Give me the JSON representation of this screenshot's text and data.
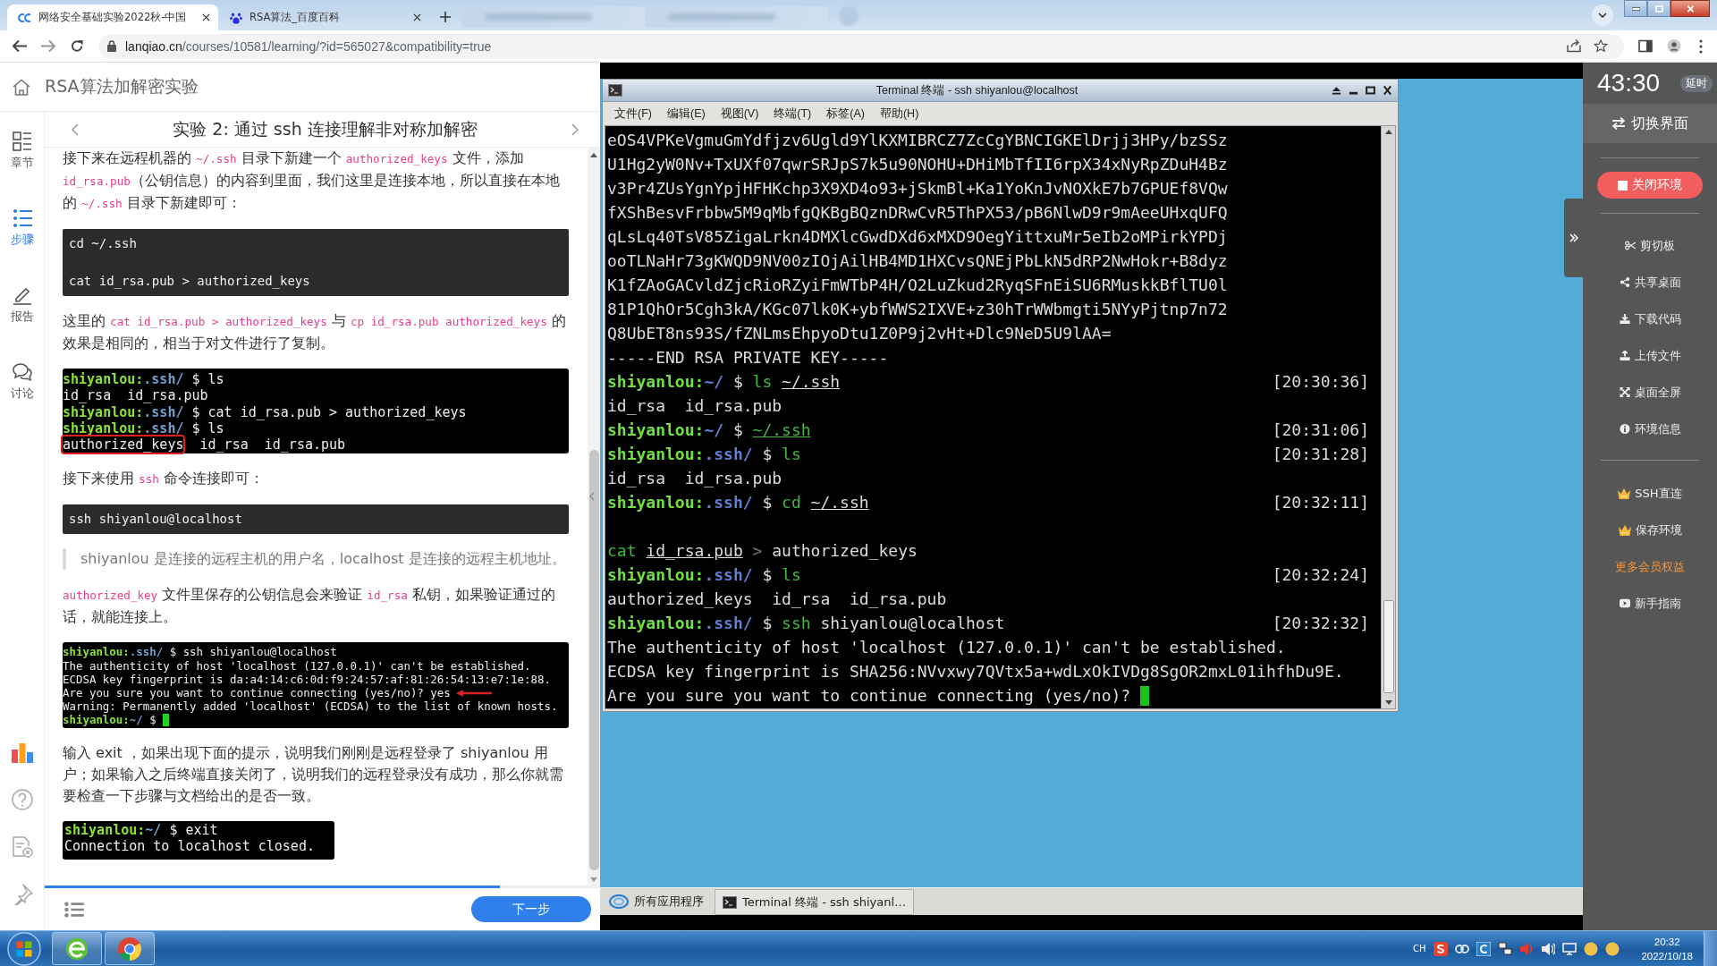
{
  "browser": {
    "tabs": [
      {
        "title": "网络安全基础实验2022秋-中国",
        "selected": true
      },
      {
        "title": "RSA算法_百度百科",
        "selected": false
      }
    ],
    "url": {
      "host": "lanqiao.cn",
      "path": "/courses/10581/learning/?id=565027&compatibility=true"
    }
  },
  "course": {
    "title": "RSA算法加解密实验",
    "rail": [
      {
        "label": "章节",
        "selected": false
      },
      {
        "label": "步骤",
        "selected": true
      },
      {
        "label": "报告",
        "selected": false
      },
      {
        "label": "讨论",
        "selected": false
      }
    ],
    "step_title": "实验 2: 通过 ssh 连接理解非对称加解密",
    "blocks": [
      {
        "kind": "para",
        "parts": [
          {
            "text": "接下来在远程机器的 ",
            "code": false
          },
          {
            "text": "~/.ssh",
            "code": true
          },
          {
            "text": " 目录下新建一个 ",
            "code": false
          },
          {
            "text": "authorized_keys",
            "code": true
          },
          {
            "text": " 文件，添加 ",
            "code": false
          },
          {
            "text": "id_rsa.pub",
            "code": true
          },
          {
            "text": "（公钥信息）的内容到里面，我们这里是连接本地，所以直接在本地的 ",
            "code": false
          },
          {
            "text": "~/.ssh",
            "code": true
          },
          {
            "text": " 目录下新建即可：",
            "code": false
          }
        ]
      },
      {
        "kind": "code",
        "text": "cd ~/.ssh\n\ncat id_rsa.pub > authorized_keys"
      },
      {
        "kind": "para",
        "parts": [
          {
            "text": "这里的 ",
            "code": false
          },
          {
            "text": "cat id_rsa.pub > authorized_keys",
            "code": true
          },
          {
            "text": " 与 ",
            "code": false
          },
          {
            "text": "cp id_rsa.pub authorized_keys",
            "code": true
          },
          {
            "text": " 的效果是相同的，相当于对文件进行了复制。",
            "code": false
          }
        ]
      },
      {
        "kind": "shot",
        "lines": [
          {
            "segments": [
              {
                "kind": "user",
                "text": "shiyanlou:"
              },
              {
                "kind": "dir",
                "text": ".ssh/"
              },
              {
                "kind": "text",
                "text": " $ ls"
              }
            ]
          },
          {
            "segments": [
              {
                "kind": "text",
                "text": "id_rsa  id_rsa.pub"
              }
            ]
          },
          {
            "segments": [
              {
                "kind": "user",
                "text": "shiyanlou:"
              },
              {
                "kind": "dir",
                "text": ".ssh/"
              },
              {
                "kind": "text",
                "text": " $ cat id_rsa.pub > authorized_keys"
              }
            ]
          },
          {
            "segments": [
              {
                "kind": "user",
                "text": "shiyanlou:"
              },
              {
                "kind": "dir",
                "text": ".ssh/"
              },
              {
                "kind": "text",
                "text": " $ ls"
              }
            ]
          },
          {
            "segments": [
              {
                "kind": "boxed",
                "text": "authorized_keys"
              },
              {
                "kind": "text",
                "text": "  id_rsa  id_rsa.pub"
              }
            ]
          }
        ]
      },
      {
        "kind": "para",
        "parts": [
          {
            "text": "接下来使用 ",
            "code": false
          },
          {
            "text": "ssh",
            "code": true
          },
          {
            "text": " 命令连接即可：",
            "code": false
          }
        ]
      },
      {
        "kind": "code",
        "text": "ssh shiyanlou@localhost"
      },
      {
        "kind": "quote",
        "text": "shiyanlou 是连接的远程主机的用户名，localhost 是连接的远程主机地址。"
      },
      {
        "kind": "para",
        "parts": [
          {
            "text": "authorized_key",
            "code": true
          },
          {
            "text": " 文件里保存的公钥信息会来验证 ",
            "code": false
          },
          {
            "text": "id_rsa",
            "code": true
          },
          {
            "text": " 私钥，如果验证通过的话，就能连接上。",
            "code": false
          }
        ]
      },
      {
        "kind": "shot",
        "lines": [
          {
            "segments": [
              {
                "kind": "user",
                "text": "shiyanlou:"
              },
              {
                "kind": "dir",
                "text": ".ssh/"
              },
              {
                "kind": "text",
                "text": " $ ssh shiyanlou@localhost"
              }
            ]
          },
          {
            "segments": [
              {
                "kind": "text",
                "text": "The authenticity of host 'localhost (127.0.0.1)' can't be established."
              }
            ]
          },
          {
            "segments": [
              {
                "kind": "text",
                "text": "ECDSA key fingerprint is da:a4:14:c6:0d:f9:24:57:af:81:26:54:13:e7:1e:88."
              }
            ]
          },
          {
            "segments": [
              {
                "kind": "text",
                "text": "Are you sure you want to continue connecting (yes/no)? yes"
              },
              {
                "kind": "arrow"
              }
            ]
          },
          {
            "segments": [
              {
                "kind": "text",
                "text": "Warning: Permanently added 'localhost' (ECDSA) to the list of known hosts."
              }
            ]
          },
          {
            "segments": [
              {
                "kind": "user",
                "text": "shiyanlou:"
              },
              {
                "kind": "dir",
                "text": "~/"
              },
              {
                "kind": "text",
                "text": " $ "
              },
              {
                "kind": "cursor"
              }
            ]
          }
        ]
      },
      {
        "kind": "para",
        "parts": [
          {
            "text": "输入 exit ，如果出现下面的提示，说明我们刚刚是远程登录了 shiyanlou 用户；如果输入之后终端直接关闭了，说明我们的远程登录没有成功，那么你就需要检查一下步骤与文档给出的是否一致。",
            "code": false
          }
        ]
      },
      {
        "kind": "shot",
        "lines": [
          {
            "segments": [
              {
                "kind": "user",
                "text": "shiyanlou:"
              },
              {
                "kind": "dir",
                "text": "~/"
              },
              {
                "kind": "text",
                "text": " $ exit"
              }
            ]
          },
          {
            "segments": [
              {
                "kind": "text",
                "text": "Connection to localhost closed."
              }
            ]
          }
        ]
      }
    ],
    "progress": {
      "level": 0.82
    },
    "next_button": "下一步"
  },
  "desktop": {
    "terminal": {
      "title": "Terminal 终端 - ssh shiyanlou@localhost",
      "menu": [
        "文件(F)",
        "编辑(E)",
        "视图(V)",
        "终端(T)",
        "标签(A)",
        "帮助(H)"
      ],
      "lines": [
        {
          "kind": "line",
          "segments": [
            {
              "kind": "text",
              "text": "eOS4VPKeVgmuGmYdfjzv6Ugld9YlKXMIBRCZ7ZcCgYBNCIGKElDrjj3HPy/bzSSz"
            }
          ]
        },
        {
          "kind": "line",
          "segments": [
            {
              "kind": "text",
              "text": "U1Hg2yW0Nv+TxUXf07qwrSRJpS7k5u90NOHU+DHiMbTfII6rpX34xNyRpZDuH4Bz"
            }
          ]
        },
        {
          "kind": "line",
          "segments": [
            {
              "kind": "text",
              "text": "v3Pr4ZUsYgnYpjHFHKchp3X9XD4o93+jSkmBl+Ka1YoKnJvNOXkE7b7GPUEf8VQw"
            }
          ]
        },
        {
          "kind": "line",
          "segments": [
            {
              "kind": "text",
              "text": "fXShBesvFrbbw5M9qMbfgQKBgBQznDRwCvR5ThPX53/pB6NlwD9r9mAeeUHxqUFQ"
            }
          ]
        },
        {
          "kind": "line",
          "segments": [
            {
              "kind": "text",
              "text": "qLsLq40TsV85ZigaLrkn4DMXlcGwdDXd6xMXD9OegYittxuMr5eIb2oMPirkYPDj"
            }
          ]
        },
        {
          "kind": "line",
          "segments": [
            {
              "kind": "text",
              "text": "ooTLNaHr73gKWQD9NV00zIOjAilHB4MD1HXCvsQNEjPbLkN5dRP2NwHokr+B8dyz"
            }
          ]
        },
        {
          "kind": "line",
          "segments": [
            {
              "kind": "text",
              "text": "K1fZAoGACvldZjcRioRZyiFmWTbP4H/O2LuZkud2RyqSFnEiSU6RMuskkBflTU0l"
            }
          ]
        },
        {
          "kind": "line",
          "segments": [
            {
              "kind": "text",
              "text": "81P1QhOr5Cgh3kA/KGc07lk0K+ybfWWS2IXVE+z30hTrWWbmgti5NYyPjtnp7n72"
            }
          ]
        },
        {
          "kind": "line",
          "segments": [
            {
              "kind": "text",
              "text": "Q8UbET8ns93S/fZNLmsEhpyoDtu1Z0P9j2vHt+Dlc9NeD5U9lAA="
            }
          ]
        },
        {
          "kind": "line",
          "segments": [
            {
              "kind": "text",
              "text": "-----END RSA PRIVATE KEY-----"
            }
          ]
        },
        {
          "kind": "line",
          "segments": [
            {
              "kind": "user",
              "text": "shiyanlou:"
            },
            {
              "kind": "dir",
              "text": "~/"
            },
            {
              "kind": "text",
              "text": " $ "
            },
            {
              "kind": "cmd",
              "text": "ls "
            },
            {
              "kind": "path",
              "text": "~/.ssh"
            }
          ],
          "time": "[20:30:36]"
        },
        {
          "kind": "line",
          "segments": [
            {
              "kind": "text",
              "text": "id_rsa  id_rsa.pub"
            }
          ]
        },
        {
          "kind": "line",
          "segments": [
            {
              "kind": "user",
              "text": "shiyanlou:"
            },
            {
              "kind": "dir",
              "text": "~/"
            },
            {
              "kind": "text",
              "text": " $ "
            },
            {
              "kind": "cmd_path",
              "text": "~/.ssh"
            }
          ],
          "time": "[20:31:06]"
        },
        {
          "kind": "line",
          "segments": [
            {
              "kind": "user",
              "text": "shiyanlou:"
            },
            {
              "kind": "dir",
              "text": ".ssh/"
            },
            {
              "kind": "text",
              "text": " $ "
            },
            {
              "kind": "cmd",
              "text": "ls"
            }
          ],
          "time": "[20:31:28]"
        },
        {
          "kind": "line",
          "segments": [
            {
              "kind": "text",
              "text": "id_rsa  id_rsa.pub"
            }
          ]
        },
        {
          "kind": "line",
          "segments": [
            {
              "kind": "user",
              "text": "shiyanlou:"
            },
            {
              "kind": "dir",
              "text": ".ssh/"
            },
            {
              "kind": "text",
              "text": " $ "
            },
            {
              "kind": "cmd",
              "text": "cd "
            },
            {
              "kind": "path",
              "text": "~/.ssh"
            }
          ],
          "time": "[20:32:11]"
        },
        {
          "kind": "blank"
        },
        {
          "kind": "line",
          "segments": [
            {
              "kind": "cmd",
              "text": "cat "
            },
            {
              "kind": "path",
              "text": "id_rsa.pub"
            },
            {
              "kind": "op",
              "text": " > "
            },
            {
              "kind": "text",
              "text": "authorized_keys"
            }
          ]
        },
        {
          "kind": "line",
          "segments": [
            {
              "kind": "user",
              "text": "shiyanlou:"
            },
            {
              "kind": "dir",
              "text": ".ssh/"
            },
            {
              "kind": "text",
              "text": " $ "
            },
            {
              "kind": "cmd",
              "text": "ls"
            }
          ],
          "time": "[20:32:24]"
        },
        {
          "kind": "line",
          "segments": [
            {
              "kind": "text",
              "text": "authorized_keys  id_rsa  id_rsa.pub"
            }
          ]
        },
        {
          "kind": "line",
          "segments": [
            {
              "kind": "user",
              "text": "shiyanlou:"
            },
            {
              "kind": "dir",
              "text": ".ssh/"
            },
            {
              "kind": "text",
              "text": " $ "
            },
            {
              "kind": "cmd",
              "text": "ssh"
            },
            {
              "kind": "text",
              "text": " shiyanlou@localhost"
            }
          ],
          "time": "[20:32:32]"
        },
        {
          "kind": "line",
          "segments": [
            {
              "kind": "text",
              "text": "The authenticity of host 'localhost (127.0.0.1)' can't be established."
            }
          ]
        },
        {
          "kind": "line",
          "segments": [
            {
              "kind": "text",
              "text": "ECDSA key fingerprint is SHA256:NVvxwy7QVtx5a+wdLxOkIVDg8SgOR2mxL01ihfhDu9E."
            }
          ]
        },
        {
          "kind": "line",
          "segments": [
            {
              "kind": "text",
              "text": "Are you sure you want to continue connecting (yes/no)? "
            },
            {
              "kind": "cursor"
            }
          ]
        }
      ]
    },
    "taskbar": {
      "apps_button": "所有应用程序",
      "task": "Terminal 终端 - ssh shiyanl…"
    }
  },
  "env_panel": {
    "timer": "43:30",
    "delay_button": "延时",
    "switch_button": "切换界面",
    "close_button": "关闭环境",
    "tools": [
      "剪切板",
      "共享桌面",
      "下载代码",
      "上传文件",
      "桌面全屏",
      "环境信息"
    ],
    "member_tools": [
      "SSH直连",
      "保存环境"
    ],
    "member_link": "更多会员权益",
    "guide_button": "新手指南"
  },
  "windows_taskbar": {
    "input_language": "CH",
    "time": "20:32",
    "date": "2022/10/18"
  }
}
